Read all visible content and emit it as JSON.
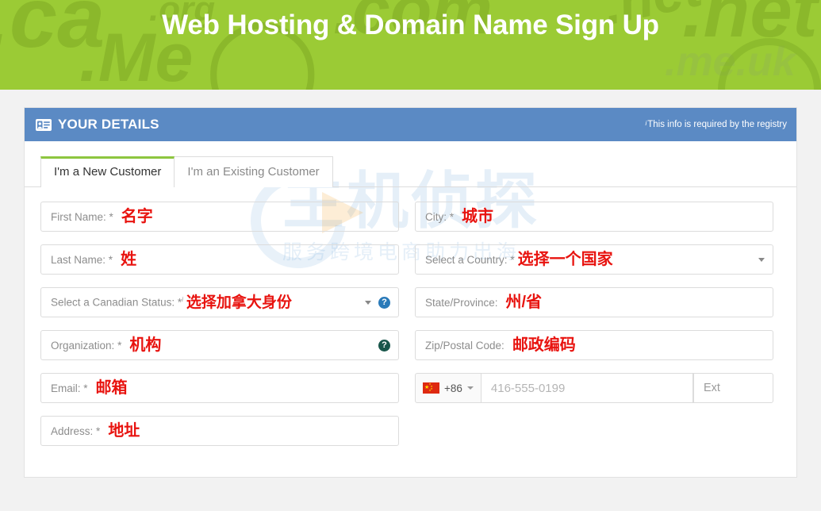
{
  "banner": {
    "title": "Web Hosting & Domain Name Sign Up",
    "background_color": "#9bcb35",
    "decorations": {
      "ca": ".ca",
      "org": ".org",
      "me": ".Me",
      "com": ".com",
      "net": ".net",
      "net2": ".net",
      "meuk": ".me.uk"
    }
  },
  "card": {
    "header": {
      "icon": "id-card-icon",
      "title": "YOUR DETAILS",
      "note_superscript": "i",
      "note": "This info is required by the registry",
      "background_color": "#5b8ac4"
    },
    "tabs": [
      {
        "label": "I'm a New Customer",
        "active": true,
        "accent_color": "#8dc63f"
      },
      {
        "label": "I'm an Existing Customer",
        "active": false
      }
    ],
    "watermark": {
      "main": "主机侦探",
      "sub": "服务跨境电商助力出海"
    }
  },
  "form": {
    "left_column": [
      {
        "label": "First Name:",
        "required_mark": "*",
        "annotation": "名字",
        "has_caret": false,
        "help_icon_color": null
      },
      {
        "label": "Last Name:",
        "required_mark": "*",
        "annotation": "姓",
        "has_caret": false,
        "help_icon_color": null
      },
      {
        "label": "Select a Canadian Status:",
        "required_mark": "*",
        "registry_mark": "i",
        "annotation": "选择加拿大身份",
        "has_caret": true,
        "help_icon_color": "#2a7ab9"
      },
      {
        "label": "Organization:",
        "required_mark": "*",
        "annotation": "机构",
        "has_caret": false,
        "help_icon_color": "#18564a"
      },
      {
        "label": "Email:",
        "required_mark": "*",
        "annotation": "邮箱",
        "has_caret": false,
        "help_icon_color": null
      },
      {
        "label": "Address:",
        "required_mark": "*",
        "annotation": "地址",
        "has_caret": false,
        "help_icon_color": null
      }
    ],
    "right_column": [
      {
        "label": "City:",
        "required_mark": "*",
        "annotation": "城市",
        "has_caret": false
      },
      {
        "label": "Select a Country:",
        "required_mark": "*",
        "annotation": "选择一个国家",
        "has_caret": true
      },
      {
        "label": "State/Province:",
        "required_mark": "",
        "annotation": "州/省",
        "has_caret": false
      },
      {
        "label": "Zip/Postal Code:",
        "required_mark": "",
        "annotation": "邮政编码",
        "has_caret": false
      }
    ],
    "phone": {
      "flag": "china-flag-icon",
      "country_code": "+86",
      "number_placeholder": "416-555-0199",
      "ext_placeholder": "Ext"
    },
    "help_icon_glyph": "?",
    "annotation_color": "#e8130f"
  }
}
